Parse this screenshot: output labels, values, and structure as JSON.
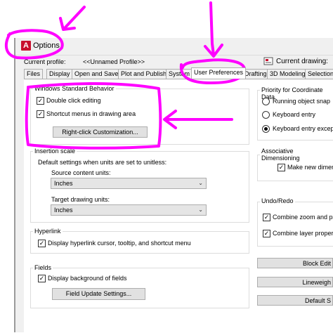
{
  "window": {
    "title": "Options",
    "app_icon": "A",
    "icon_name": "autocad-app-icon"
  },
  "profile": {
    "label": "Current profile:",
    "value": "<<Unnamed Profile>>",
    "drawing_label": "Current drawing:"
  },
  "tabs": [
    {
      "label": "Files"
    },
    {
      "label": "Display"
    },
    {
      "label": "Open and Save"
    },
    {
      "label": "Plot and Publish"
    },
    {
      "label": "System"
    },
    {
      "label": "User Preferences"
    },
    {
      "label": "Drafting"
    },
    {
      "label": "3D Modeling"
    },
    {
      "label": "Selection"
    }
  ],
  "active_tab": "User Preferences",
  "windows_behavior": {
    "title": "Windows Standard Behavior",
    "double_click_label": "Double click editing",
    "double_click_checked": true,
    "shortcut_label": "Shortcut menus in drawing area",
    "shortcut_checked": true,
    "right_click_button": "Right-click Customization..."
  },
  "insertion_scale": {
    "title": "Insertion scale",
    "description": "Default settings when units are set to unitless:",
    "source_label": "Source content units:",
    "source_value": "Inches",
    "target_label": "Target drawing units:",
    "target_value": "Inches"
  },
  "hyperlink": {
    "title": "Hyperlink",
    "label": "Display hyperlink cursor, tooltip, and shortcut menu",
    "checked": true
  },
  "fields": {
    "title": "Fields",
    "display_label": "Display background of fields",
    "display_checked": true,
    "update_button": "Field Update Settings..."
  },
  "priority": {
    "title": "Priority for Coordinate Data",
    "options": [
      {
        "label": "Running object snap",
        "checked": false
      },
      {
        "label": "Keyboard entry",
        "checked": false
      },
      {
        "label": "Keyboard entry except s",
        "checked": true
      }
    ]
  },
  "associative": {
    "title": "Associative Dimensioning",
    "label": "Make new dimens",
    "checked": true
  },
  "undo_redo": {
    "title": "Undo/Redo",
    "combine_zoom_label": "Combine zoom and pan",
    "combine_zoom_checked": true,
    "combine_layer_label": "Combine layer property",
    "combine_layer_checked": true
  },
  "right_buttons": {
    "block_edit": "Block Edit",
    "lineweight": "Lineweigh",
    "default_scale": "Default S"
  },
  "colors": {
    "annotation": "#ff00ff",
    "app_red": "#c8102e",
    "dialog_bg": "#f0f0f0"
  }
}
